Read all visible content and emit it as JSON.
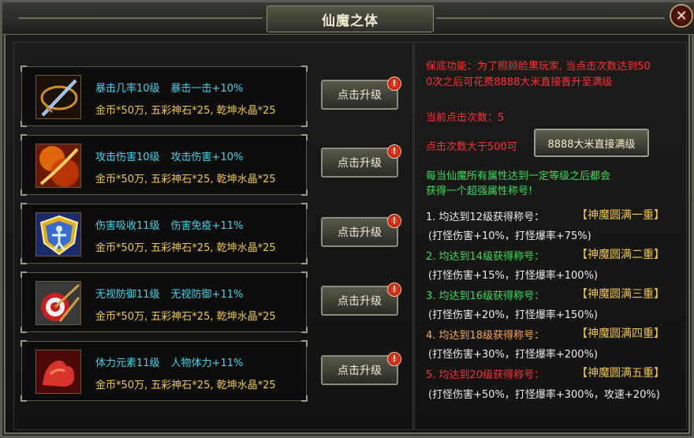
{
  "window": {
    "title": "仙魔之体",
    "close_label": "✕"
  },
  "skills": [
    {
      "name": "暴击几率10级",
      "effect": "暴击一击+10%",
      "cost": "金币*50万, 五彩神石*25, 乾坤水晶*25",
      "button": "点击升级",
      "badge": "!"
    },
    {
      "name": "攻击伤害10级",
      "effect": "攻击伤害+10%",
      "cost": "金币*50万, 五彩神石*25, 乾坤水晶*25",
      "button": "点击升级",
      "badge": "!"
    },
    {
      "name": "伤害吸收11级",
      "effect": "伤害免疫+11%",
      "cost": "金币*50万, 五彩神石*25, 乾坤水晶*25",
      "button": "点击升级",
      "badge": "!"
    },
    {
      "name": "无视防御11级",
      "effect": "无视防御+11%",
      "cost": "金币*50万, 五彩神石*25, 乾坤水晶*25",
      "button": "点击升级",
      "badge": "!"
    },
    {
      "name": "体力元素11级",
      "effect": "人物体力+11%",
      "cost": "金币*50万, 五彩神石*25, 乾坤水晶*25",
      "button": "点击升级",
      "badge": "!"
    }
  ],
  "info": {
    "guarantee_line1": "保底功能：为了照顾脸黑玩家, 当点击次数达到50",
    "guarantee_line2": "0次之后可花费8888大米直接晋升至满级",
    "click_count": "当前点击次数：5",
    "over_500": "点击次数大于500可",
    "direct_button": "8888大米直接满级",
    "desc_line1": "每当仙魔所有属性达到一定等级之后都会",
    "desc_line2": "获得一个超强属性称号!"
  },
  "titles": [
    {
      "req": "1. 均达到12级获得称号：",
      "name": "【神魔圆满一重】",
      "bonus": "(打怪伤害+10%，打怪爆率+75%)",
      "color": "white"
    },
    {
      "req": "2. 均达到14级获得称号：",
      "name": "【神魔圆满二重】",
      "bonus": "(打怪伤害+15%，打怪爆率+100%)",
      "color": "green"
    },
    {
      "req": "3. 均达到16级获得称号：",
      "name": "【神魔圆满三重】",
      "bonus": "(打怪伤害+20%，打怪爆率+150%)",
      "color": "green"
    },
    {
      "req": "4. 均达到18级获得称号：",
      "name": "【神魔圆满四重】",
      "bonus": "(打怪伤害+30%，打怪爆率+200%)",
      "color": "orange"
    },
    {
      "req": "5. 均达到20级获得称号：",
      "name": "【神魔圆满五重】",
      "bonus": "(打怪伤害+50%，打怪爆率+300%，攻速+20%)",
      "color": "red"
    }
  ],
  "icons": [
    "sword-crit-icon",
    "fire-blade-icon",
    "shield-absorb-icon",
    "target-pierce-icon",
    "muscle-arm-icon"
  ]
}
